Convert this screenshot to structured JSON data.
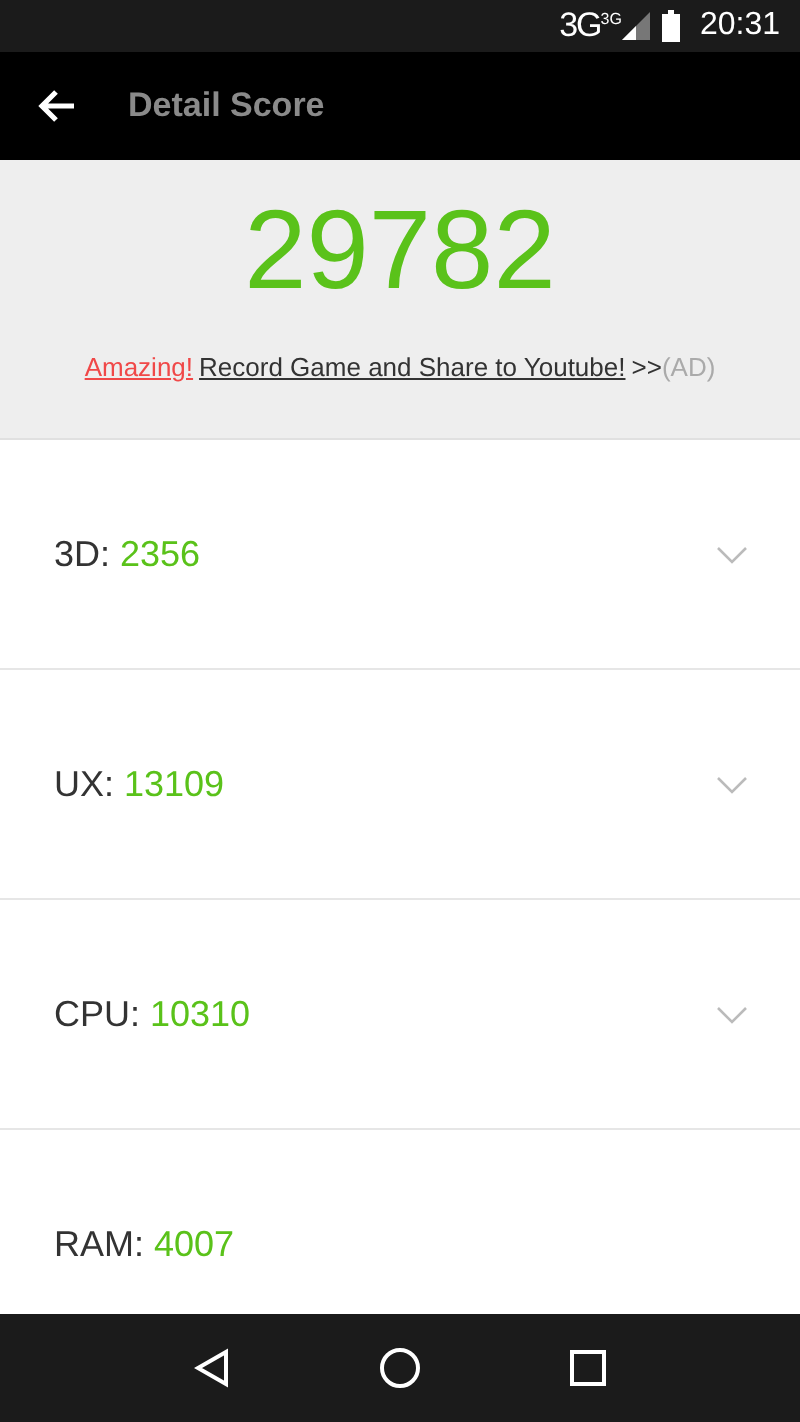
{
  "status_bar": {
    "network": "3G",
    "network_small": "3G",
    "time": "20:31"
  },
  "app_bar": {
    "title": "Detail Score"
  },
  "total_score": "29782",
  "ad": {
    "highlight": "Amazing!",
    "link": "Record Game and Share to Youtube!",
    "arrows": ">>",
    "tag": "(AD)"
  },
  "scores": [
    {
      "label": "3D:",
      "value": "2356",
      "expandable": true
    },
    {
      "label": "UX:",
      "value": "13109",
      "expandable": true
    },
    {
      "label": "CPU:",
      "value": "10310",
      "expandable": true
    },
    {
      "label": "RAM:",
      "value": "4007",
      "expandable": false
    }
  ]
}
